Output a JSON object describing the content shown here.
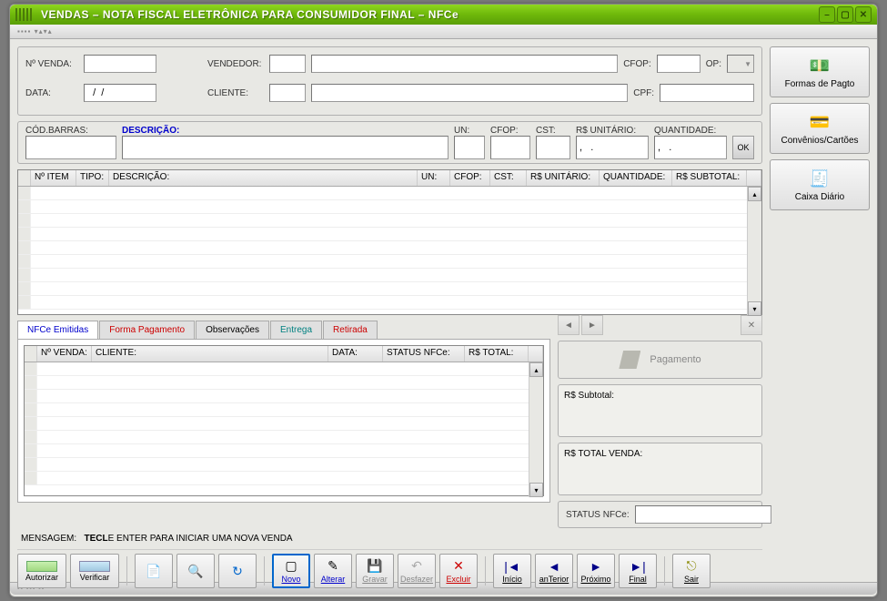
{
  "window": {
    "title": "VENDAS – NOTA FISCAL ELETRÔNICA PARA CONSUMIDOR FINAL – NFCe"
  },
  "header": {
    "n_venda_label": "Nº VENDA:",
    "n_venda_value": "",
    "data_label": "DATA:",
    "data_value": "  /  /",
    "vendedor_label": "VENDEDOR:",
    "vendedor_code": "",
    "vendedor_name": "",
    "cfop_label": "CFOP:",
    "cfop_value": "",
    "op_label": "OP:",
    "op_value": "",
    "cliente_label": "CLIENTE:",
    "cliente_code": "",
    "cliente_name": "",
    "cpf_label": "CPF:",
    "cpf_value": ""
  },
  "item_entry": {
    "cod_barras_label": "CÓD.BARRAS:",
    "cod_barras_value": "",
    "descricao_label": "DESCRIÇÃO:",
    "descricao_value": "",
    "un_label": "UN:",
    "un_value": "",
    "cfop_label": "CFOP:",
    "cfop_value": "",
    "cst_label": "CST:",
    "cst_value": "",
    "unitario_label": "R$ UNITÁRIO:",
    "unitario_value": ",   .",
    "quantidade_label": "QUANTIDADE:",
    "quantidade_value": ",   .",
    "ok_label": "OK"
  },
  "items_grid": {
    "headers": {
      "n_item": "Nº ITEM",
      "tipo": "TIPO:",
      "descricao": "DESCRIÇÃO:",
      "un": "UN:",
      "cfop": "CFOP:",
      "cst": "CST:",
      "unitario": "R$ UNITÁRIO:",
      "quantidade": "QUANTIDADE:",
      "subtotal": "R$ SUBTOTAL:"
    }
  },
  "tabs": {
    "nfce_emitidas": "NFCe Emitidas",
    "forma_pagamento": "Forma Pagamento",
    "observacoes": "Observações",
    "entrega": "Entrega",
    "retirada": "Retirada"
  },
  "sales_grid": {
    "headers": {
      "n_venda": "Nº VENDA:",
      "cliente": "CLIENTE:",
      "data": "DATA:",
      "status": "STATUS NFCe:",
      "total": "R$ TOTAL:"
    }
  },
  "payment": {
    "pagamento_label": "Pagamento",
    "subtotal_label": "R$ Subtotal:",
    "subtotal_value": "",
    "total_venda_label": "R$ TOTAL VENDA:",
    "total_venda_value": "",
    "status_label": "STATUS NFCe:",
    "status_value": ""
  },
  "message": {
    "label": "MENSAGEM:",
    "bold": "TECL",
    "text": "E ENTER PARA INICIAR UMA NOVA VENDA"
  },
  "side_buttons": {
    "formas_pagto": "Formas de Pagto",
    "convenios": "Convênios/Cartões",
    "caixa_diario": "Caixa Diário"
  },
  "toolbar": {
    "autorizar": "Autorizar",
    "verificar": "Verificar",
    "novo": "Novo",
    "alterar": "Alterar",
    "gravar": "Gravar",
    "desfazer": "Desfazer",
    "excluir": "Excluir",
    "inicio": "Início",
    "anterior": "anTerior",
    "proximo": "Próximo",
    "final": "Final",
    "sair": "Sair"
  }
}
